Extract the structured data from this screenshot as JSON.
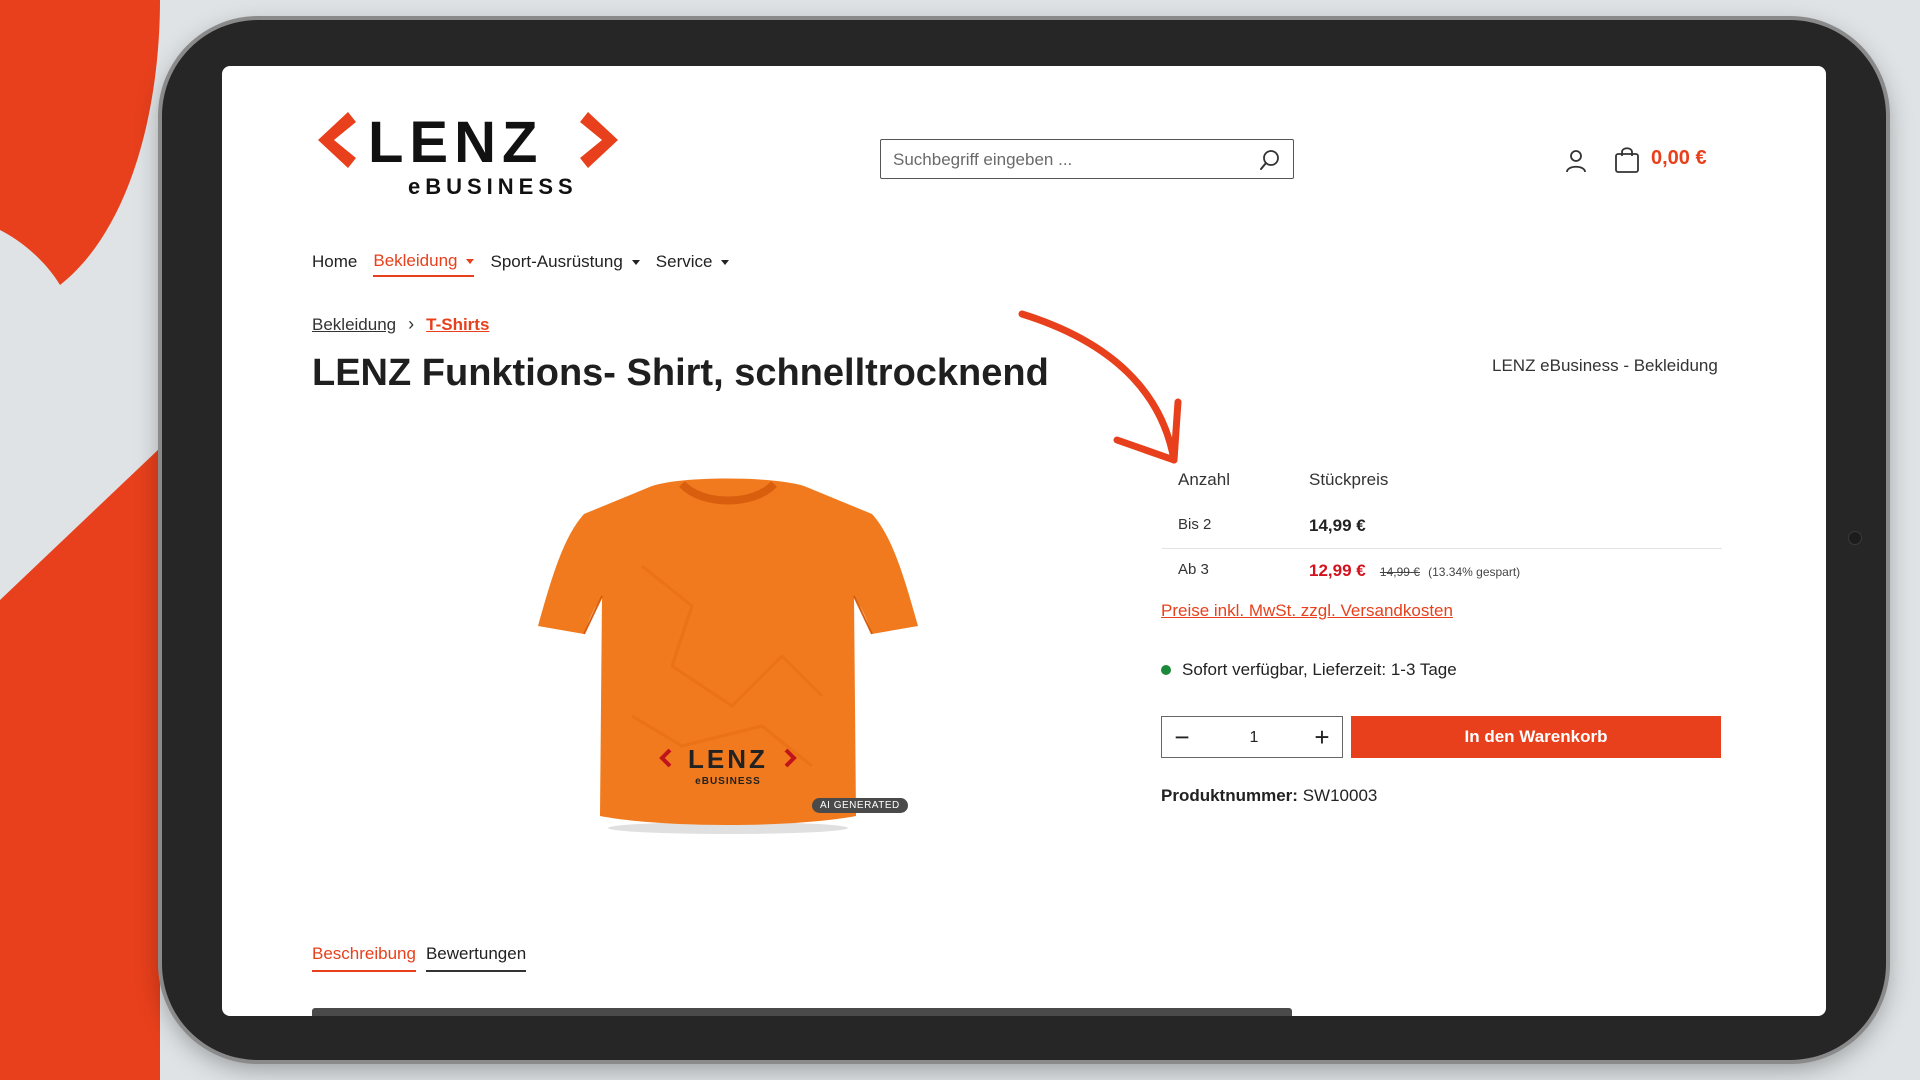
{
  "brand": {
    "name": "LENZ",
    "tagline": "eBUSINESS",
    "accent_color": "#e8401c",
    "sale_color": "#d4121e"
  },
  "header": {
    "search": {
      "placeholder": "Suchbegriff eingeben ..."
    },
    "account_icon": "user-icon",
    "cart_icon": "shopping-bag-icon",
    "cart_total": "0,00 €"
  },
  "nav": {
    "items": [
      {
        "label": "Home",
        "active": false,
        "dropdown": false
      },
      {
        "label": "Bekleidung",
        "active": true,
        "dropdown": true
      },
      {
        "label": "Sport-Ausrüstung",
        "active": false,
        "dropdown": true
      },
      {
        "label": "Service",
        "active": false,
        "dropdown": true
      }
    ]
  },
  "breadcrumb": {
    "items": [
      "Bekleidung",
      "T-Shirts"
    ],
    "separator": "›"
  },
  "product": {
    "title": "LENZ Funktions- Shirt, schnelltrocknend",
    "manufacturer": "LENZ eBusiness - Bekleidung",
    "image_badge": "AI GENERATED",
    "shirt_logo_main": "LENZ",
    "shirt_logo_sub": "eBUSINESS",
    "price_table": {
      "headers": [
        "Anzahl",
        "Stückpreis"
      ],
      "rows": [
        {
          "qty": "Bis 2",
          "price": "14,99 €",
          "old_price": "",
          "saved": ""
        },
        {
          "qty": "Ab 3",
          "price": "12,99 €",
          "old_price": "14,99 €",
          "saved": "(13.34% gespart)"
        }
      ]
    },
    "vat_link": "Preise inkl. MwSt. zzgl. Versandkosten",
    "availability": "Sofort verfügbar, Lieferzeit: 1-3 Tage",
    "availability_color": "#1a8a3a",
    "quantity": {
      "value": "1",
      "minus": "−",
      "plus": "+"
    },
    "add_to_cart": "In den Warenkorb",
    "sku_label": "Produktnummer:",
    "sku_value": "SW10003"
  },
  "tabs": {
    "items": [
      "Beschreibung",
      "Bewertungen"
    ],
    "active_index": 0
  }
}
